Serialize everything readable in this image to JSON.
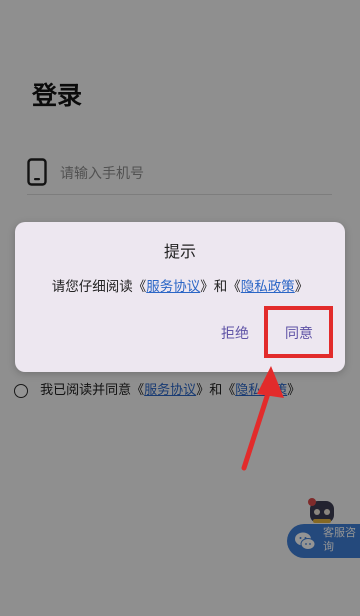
{
  "login": {
    "title": "登录",
    "phone_placeholder": "请输入手机号"
  },
  "agreement": {
    "prefix": "我已阅读并同意",
    "left_quote": "《",
    "service": "服务协议",
    "mid": "》和《",
    "privacy": "隐私政策",
    "right_quote": "》"
  },
  "dialog": {
    "title": "提示",
    "message_prefix": "请您仔细阅读",
    "left_quote": "《",
    "service": "服务协议",
    "mid": "》和《",
    "privacy": "隐私政策",
    "right_quote": "》",
    "reject_label": "拒绝",
    "agree_label": "同意"
  },
  "customer_service": {
    "label": "客服咨询"
  },
  "colors": {
    "accent": "#5f53a6",
    "link": "#2b66c6",
    "annotation": "#e22b2b",
    "service_badge": "#3f7ed6"
  },
  "icons": [
    "phone-icon",
    "robot-icon",
    "wechat-chat-icon",
    "pointer-arrow"
  ]
}
